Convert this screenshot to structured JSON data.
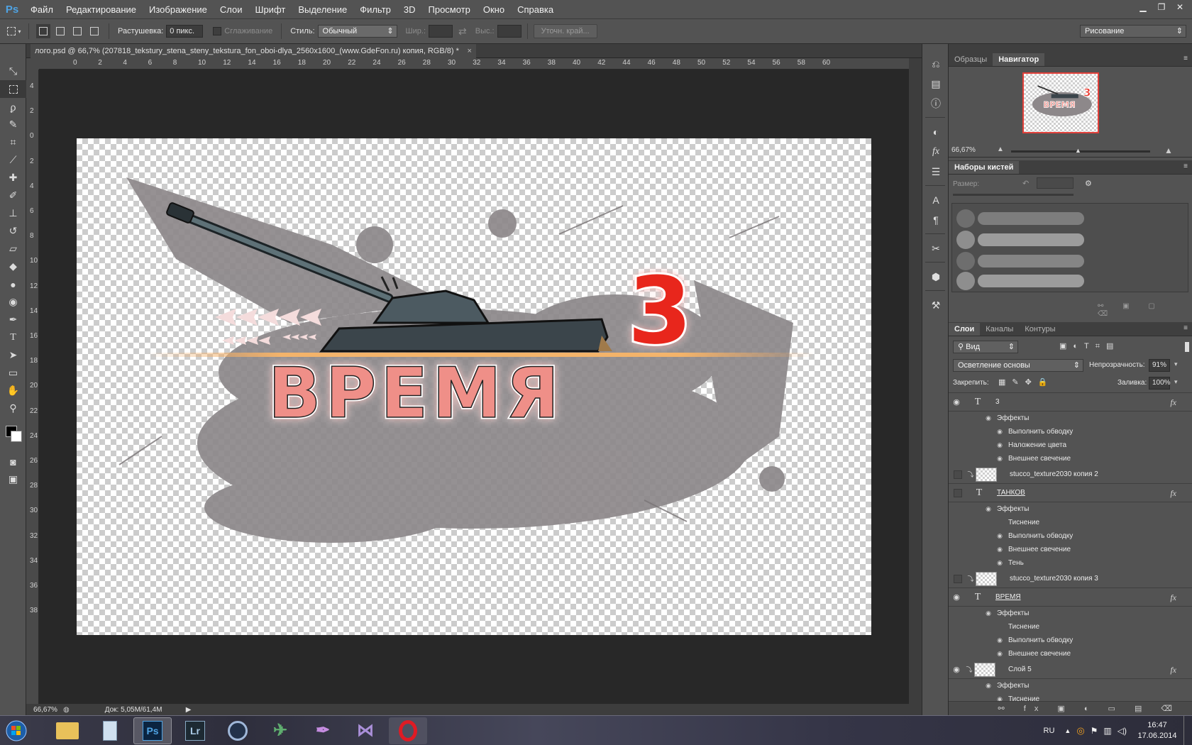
{
  "app": {
    "logo": "Ps"
  },
  "menu": [
    "Файл",
    "Редактирование",
    "Изображение",
    "Слои",
    "Шрифт",
    "Выделение",
    "Фильтр",
    "3D",
    "Просмотр",
    "Окно",
    "Справка"
  ],
  "options": {
    "feather_label": "Растушевка:",
    "feather_value": "0 пикс.",
    "antialias_label": "Сглаживание",
    "style_label": "Стиль:",
    "style_value": "Обычный",
    "width_label": "Шир.:",
    "height_label": "Выс.:",
    "refine_edge": "Уточн. край...",
    "workspace": "Рисование"
  },
  "document": {
    "tab_title": "лого.psd @ 66,7% (207818_tekstury_stena_steny_tekstura_fon_oboi-dlya_2560x1600_(www.GdeFon.ru) копия, RGB/8) *",
    "close": "×"
  },
  "ruler": {
    "top_labels": [
      "0",
      "2",
      "4",
      "6",
      "8",
      "10",
      "12",
      "14",
      "16",
      "18",
      "20",
      "22",
      "24",
      "26",
      "28",
      "30",
      "32",
      "34",
      "36",
      "38",
      "40",
      "42",
      "44",
      "46",
      "48",
      "50",
      "52",
      "54",
      "56",
      "58",
      "60"
    ],
    "left_labels": [
      "4",
      "2",
      "0",
      "2",
      "4",
      "6",
      "8",
      "10",
      "12",
      "14",
      "16",
      "18",
      "20",
      "22",
      "24",
      "26",
      "28",
      "30",
      "32",
      "34",
      "36",
      "38"
    ]
  },
  "artwork": {
    "title_word": "ВРЕМЯ",
    "number": "3"
  },
  "status": {
    "zoom": "66,67%",
    "doc": "Док: 5,05M/61,4M"
  },
  "navigator": {
    "tabs": [
      "Образцы",
      "Навигатор"
    ],
    "zoom": "66,67%",
    "thumb_word": "ВРЕМЯ",
    "thumb_number": "3"
  },
  "brushes": {
    "title": "Наборы кистей",
    "size_label": "Размер:"
  },
  "layers": {
    "tabs": [
      "Слои",
      "Каналы",
      "Контуры"
    ],
    "filter": "Вид",
    "blend_mode": "Осветление основы",
    "opacity_label": "Непрозрачность:",
    "opacity_value": "91%",
    "lock_label": "Закрепить:",
    "fill_label": "Заливка:",
    "fill_value": "100%",
    "rows": [
      {
        "type": "text",
        "name": "3",
        "visible": true,
        "fx": true
      },
      {
        "type": "effect-header",
        "name": "Эффекты"
      },
      {
        "type": "effect",
        "name": "Выполнить обводку"
      },
      {
        "type": "effect",
        "name": "Наложение цвета"
      },
      {
        "type": "effect",
        "name": "Внешнее свечение"
      },
      {
        "type": "pixel",
        "name": "stucco_texture2030 копия 2",
        "visible": false
      },
      {
        "type": "text",
        "name": "ТАНКОВ",
        "visible": false,
        "fx": true
      },
      {
        "type": "effect-header",
        "name": "Эффекты"
      },
      {
        "type": "effect-noeye",
        "name": "Тиснение"
      },
      {
        "type": "effect",
        "name": "Выполнить обводку"
      },
      {
        "type": "effect",
        "name": "Внешнее свечение"
      },
      {
        "type": "effect",
        "name": "Тень"
      },
      {
        "type": "pixel",
        "name": "stucco_texture2030 копия 3",
        "visible": false
      },
      {
        "type": "text",
        "name": "ВРЕМЯ",
        "visible": true,
        "fx": true
      },
      {
        "type": "effect-header",
        "name": "Эффекты"
      },
      {
        "type": "effect-noeye",
        "name": "Тиснение"
      },
      {
        "type": "effect",
        "name": "Выполнить обводку"
      },
      {
        "type": "effect",
        "name": "Внешнее свечение"
      },
      {
        "type": "pixel",
        "name": "Слой 5",
        "visible": true,
        "fx": true
      },
      {
        "type": "effect-header",
        "name": "Эффекты"
      },
      {
        "type": "effect",
        "name": "Тиснение"
      }
    ]
  },
  "taskbar": {
    "apps": [
      "explorer",
      "calculator",
      "Ps",
      "Lr",
      "cinema4d",
      "game",
      "feather",
      "vs",
      "opera"
    ],
    "lang": "RU",
    "time": "16:47",
    "date": "17.06.2014"
  },
  "colors": {
    "accent_red": "#e2403a",
    "panel": "#535353",
    "canvas_bg": "#282828"
  }
}
